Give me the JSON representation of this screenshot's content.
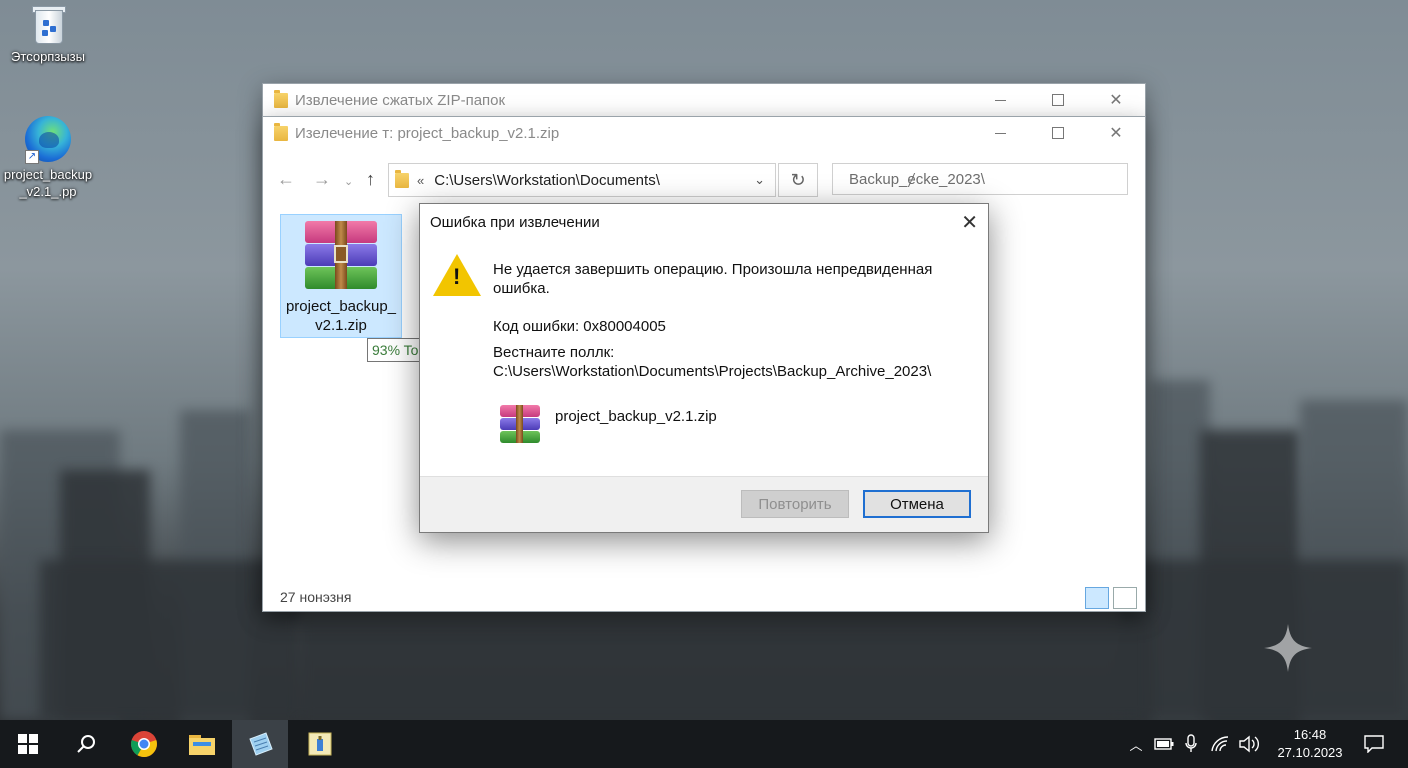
{
  "desktop": {
    "icons": [
      {
        "label": "Этсорпзызы"
      },
      {
        "label": "project_backup _v2.1_.pp"
      }
    ]
  },
  "explorer_back": {
    "title": "Извлечение сжатых ZIP-папок"
  },
  "explorer": {
    "title": "Изелечение т: project_backup_v2.1.zip",
    "address": "C:\\Users\\Workstation\\Documents\\",
    "address_prefix": "«",
    "search_value": "Backup_ɇcke_2023\\",
    "file": {
      "name_line1": "project_backup_",
      "name_line2": "v2.1.zip"
    },
    "tooltip": "93% To",
    "status": "27 нонэзня"
  },
  "dialog": {
    "title": "Ошибка при извлечении",
    "message_line1": "Не удается завершить операцию. Произошла непредвиденная",
    "message_line2": "ошибка.",
    "error_code": "Код ошибки: 0x80004005",
    "path_label": "Вестнаите поллк:",
    "path_value": "C:\\Users\\Workstation\\Documents\\Projects\\Backup_Archive_2023\\",
    "file_name": "project_backup_v2.1.zip",
    "retry_label": "Повторить",
    "cancel_label": "Отмена"
  },
  "taskbar": {
    "time": "16:48",
    "date": "27.10.2023"
  },
  "colors": {
    "accent": "#1f6fd1",
    "selection": "#cce8ff",
    "warning": "#f2c500"
  }
}
